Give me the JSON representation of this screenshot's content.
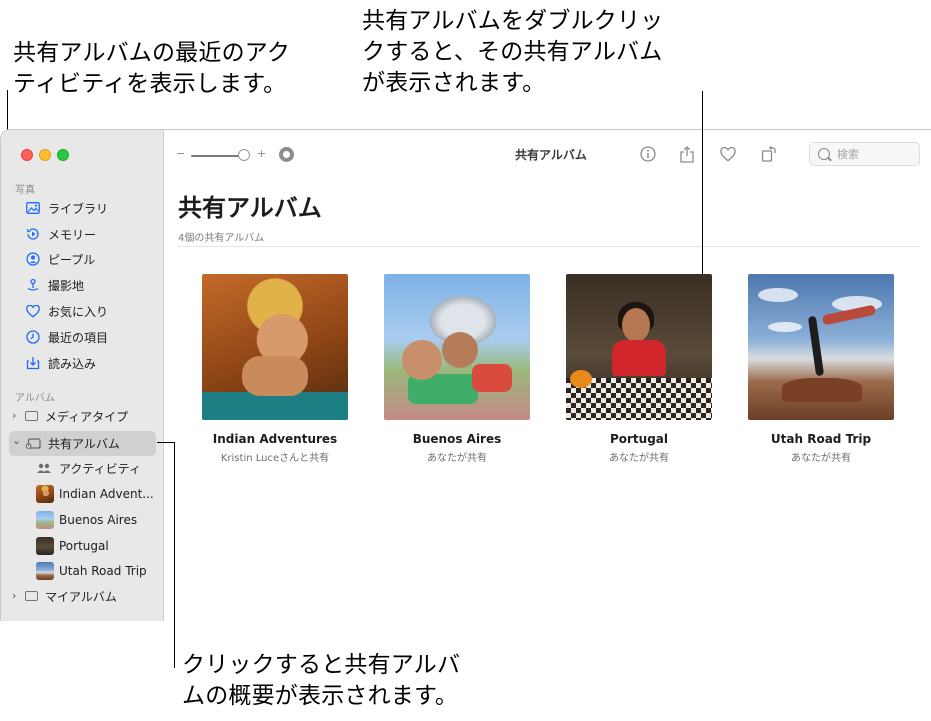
{
  "callouts": {
    "top_left": "共有アルバムの最近のアク\nティビティを表示します。",
    "top_right": "共有アルバムをダブルクリッ\nクすると、その共有アルバム\nが表示されます。",
    "bottom": "クリックすると共有アルバ\nムの概要が表示されます。"
  },
  "sidebar": {
    "section_photos": "写真",
    "items": [
      {
        "label": "ライブラリ",
        "icon": "photo-library-icon"
      },
      {
        "label": "メモリー",
        "icon": "memories-icon"
      },
      {
        "label": "ピープル",
        "icon": "people-icon"
      },
      {
        "label": "撮影地",
        "icon": "places-icon"
      },
      {
        "label": "お気に入り",
        "icon": "heart-icon"
      },
      {
        "label": "最近の項目",
        "icon": "clock-icon"
      },
      {
        "label": "読み込み",
        "icon": "import-icon"
      }
    ],
    "section_albums": "アルバム",
    "media_types": "メディアタイプ",
    "shared_albums": "共有アルバム",
    "activity": "アクティビティ",
    "shared_children": [
      {
        "label": "Indian Advent..."
      },
      {
        "label": "Buenos Aires"
      },
      {
        "label": "Portugal"
      },
      {
        "label": "Utah Road Trip"
      }
    ],
    "my_albums": "マイアルバム"
  },
  "toolbar": {
    "title": "共有アルバム",
    "zoom_minus": "−",
    "zoom_plus": "+",
    "search_placeholder": "検索"
  },
  "main": {
    "title": "共有アルバム",
    "subtitle": "4個の共有アルバム",
    "albums": [
      {
        "title": "Indian Adventures",
        "subtitle": "Kristin Luceさんと共有"
      },
      {
        "title": "Buenos Aires",
        "subtitle": "あなたが共有"
      },
      {
        "title": "Portugal",
        "subtitle": "あなたが共有"
      },
      {
        "title": "Utah Road Trip",
        "subtitle": "あなたが共有"
      }
    ]
  },
  "colors": {
    "accent": "#1f6bff",
    "sidebar_bg": "#e8e8e8",
    "selected_bg": "#d0d0d0"
  }
}
